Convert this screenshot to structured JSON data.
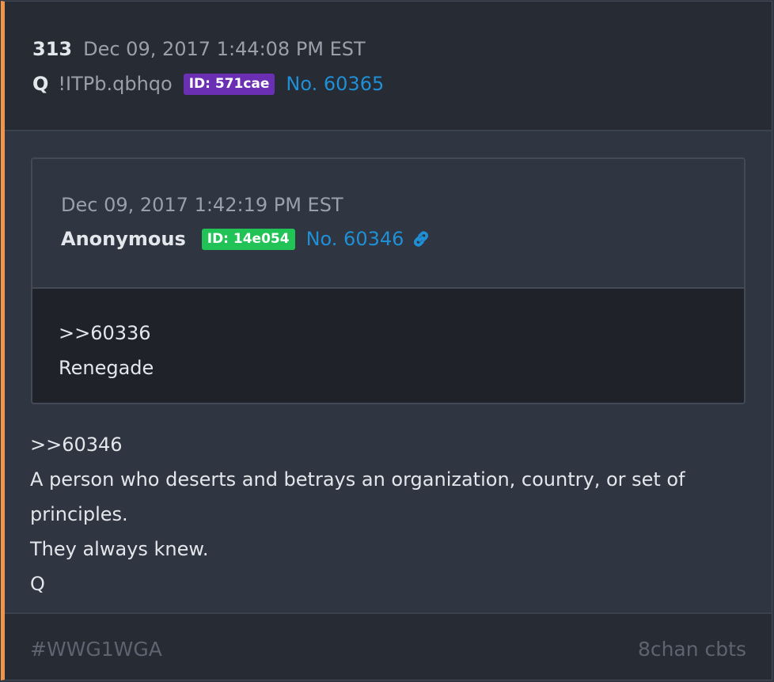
{
  "post": {
    "number": "313",
    "date": "Dec 09, 2017 1:44:08 PM EST",
    "author": "Q",
    "tripcode": "!ITPb.qbhqo",
    "id_label": "ID: 571cae",
    "id_color": "#6b2fb3",
    "post_no": "No. 60365"
  },
  "quoted": {
    "date": "Dec 09, 2017 1:42:19 PM EST",
    "author": "Anonymous",
    "id_label": "ID: 14e054",
    "id_color": "#21c356",
    "post_no": "No. 60346",
    "link_icon": "link-icon",
    "lines": [
      ">>60336",
      "Renegade"
    ]
  },
  "body": {
    "lines": [
      ">>60346",
      "A person who deserts and betrays an organization, country, or set of",
      "principles.",
      "They always knew.",
      "Q"
    ]
  },
  "footer": {
    "tag": "#WWG1WGA",
    "source": "8chan cbts"
  },
  "colors": {
    "accent_border": "#f0964a",
    "link": "#1f8fd6"
  }
}
